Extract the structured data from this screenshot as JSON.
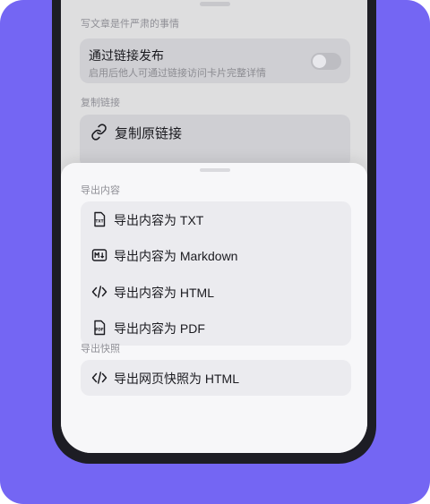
{
  "background_page": {
    "top_section_label": "写文章是件严肃的事情",
    "publish_card": {
      "title": "通过链接发布",
      "subtitle": "启用后他人可通过链接访问卡片完整详情",
      "toggle_on": false
    },
    "copy_section_label": "复制链接",
    "copy_original_link": "复制原链接"
  },
  "sheet": {
    "export_content_label": "导出内容",
    "export_items": [
      {
        "label": "导出内容为 TXT",
        "icon": "txt-file-icon"
      },
      {
        "label": "导出内容为 Markdown",
        "icon": "markdown-icon"
      },
      {
        "label": "导出内容为 HTML",
        "icon": "code-icon"
      },
      {
        "label": "导出内容为 PDF",
        "icon": "pdf-file-icon"
      }
    ],
    "export_snapshot_label": "导出快照",
    "snapshot_items": [
      {
        "label": "导出网页快照为 HTML",
        "icon": "code-icon"
      }
    ]
  },
  "colors": {
    "frame_background": "#7466f3",
    "phone_bezel": "#1d1d24",
    "sheet_background": "#f7f7f9",
    "card_background": "#ebebef"
  }
}
